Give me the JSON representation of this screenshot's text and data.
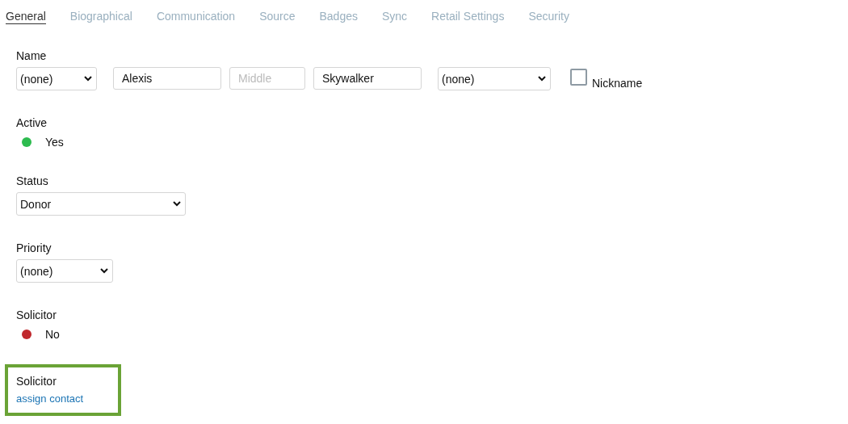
{
  "tabs": [
    {
      "label": "General",
      "selected": true
    },
    {
      "label": "Biographical",
      "selected": false
    },
    {
      "label": "Communication",
      "selected": false
    },
    {
      "label": "Source",
      "selected": false
    },
    {
      "label": "Badges",
      "selected": false
    },
    {
      "label": "Sync",
      "selected": false
    },
    {
      "label": "Retail Settings",
      "selected": false
    },
    {
      "label": "Security",
      "selected": false
    }
  ],
  "name": {
    "label": "Name",
    "prefix": "(none)",
    "first": "Alexis",
    "middle_placeholder": "Middle",
    "last": "Skywalker",
    "suffix": "(none)",
    "nickname": {
      "label": "Nickname",
      "checked": false
    }
  },
  "fields": [
    {
      "kind": "indicator",
      "label": "Active",
      "value": "Yes",
      "color": "#2dbb4f"
    },
    {
      "kind": "select",
      "label": "Status",
      "value": "Donor"
    },
    {
      "kind": "select",
      "label": "Priority",
      "value": "(none)"
    },
    {
      "kind": "indicator",
      "label": "Solicitor",
      "value": "No",
      "color": "#c0282d"
    },
    {
      "kind": "link",
      "label": "Solicitor",
      "link": "assign contact",
      "highlighted": true
    }
  ]
}
